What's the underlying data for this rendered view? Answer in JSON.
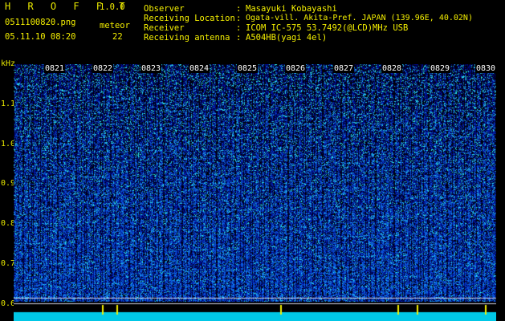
{
  "app": {
    "name": "H R O F F T",
    "version": "1.0.0"
  },
  "file": {
    "name": "0511100820.png",
    "datetime": "05.11.10 08:20"
  },
  "meteor": {
    "label": "meteor",
    "count": "22"
  },
  "info": [
    {
      "key": "Observer",
      "value": "Masayuki Kobayashi"
    },
    {
      "key": "Receiving Location",
      "value": "Ogata-vill. Akita-Pref. JAPAN (139.96E, 40.02N)"
    },
    {
      "key": "Receiver",
      "value": "ICOM IC-575 53.7492(@LCD)MHz USB"
    },
    {
      "key": "Receiving antenna",
      "value": "A504HB(yagi 4el)"
    }
  ],
  "yaxis": {
    "unit": "kHz",
    "ticks": [
      "1.1",
      "1.0",
      "0.9",
      "0.8",
      "0.7",
      "0.6"
    ]
  },
  "time_labels": [
    "0821",
    "0822",
    "0823",
    "0824",
    "0825",
    "0826",
    "0827",
    "0828",
    "0829",
    "0830"
  ],
  "colors": {
    "accent": "#f5f000",
    "label": "#ffffff",
    "background": "#000000",
    "signal_low": "#00ffff"
  }
}
